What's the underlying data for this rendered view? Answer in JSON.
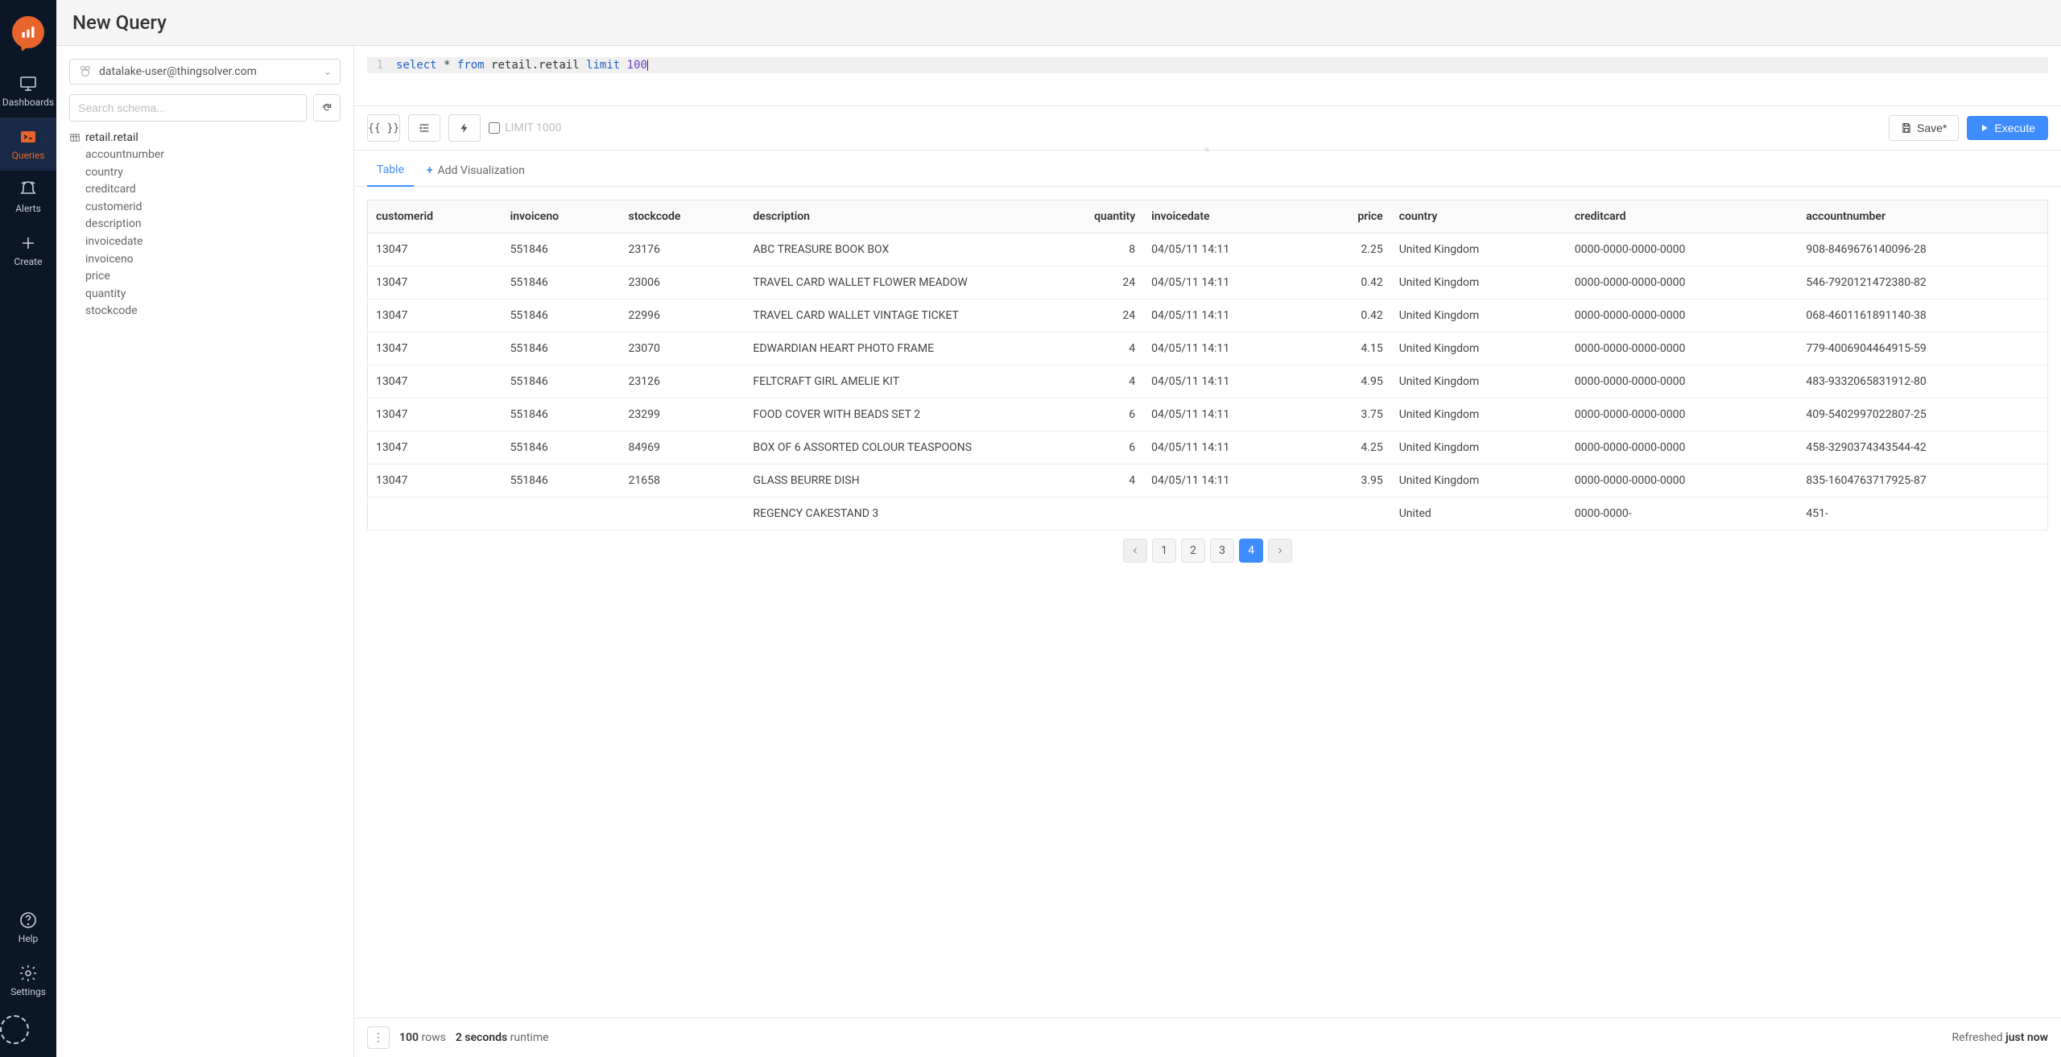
{
  "page_title": "New Query",
  "sidebar": {
    "items": [
      {
        "id": "dashboards",
        "label": "Dashboards"
      },
      {
        "id": "queries",
        "label": "Queries"
      },
      {
        "id": "alerts",
        "label": "Alerts"
      },
      {
        "id": "create",
        "label": "Create"
      }
    ],
    "bottom": [
      {
        "id": "help",
        "label": "Help"
      },
      {
        "id": "settings",
        "label": "Settings"
      }
    ]
  },
  "connection": {
    "selected": "datalake-user@thingsolver.com"
  },
  "schema_search_placeholder": "Search schema...",
  "schema": {
    "table": "retail.retail",
    "columns": [
      "accountnumber",
      "country",
      "creditcard",
      "customerid",
      "description",
      "invoicedate",
      "invoiceno",
      "price",
      "quantity",
      "stockcode"
    ]
  },
  "query": {
    "line_no": "1",
    "tokens": {
      "select": "select",
      "star": "*",
      "from": "from",
      "table": "retail.retail",
      "limit": "limit",
      "n": "100"
    }
  },
  "toolbar": {
    "format_btn": "{{ }}",
    "limit_label": "LIMIT 1000",
    "save_label": "Save*",
    "execute_label": "Execute"
  },
  "tabs": {
    "table": "Table",
    "add": "Add Visualization"
  },
  "columns": [
    "customerid",
    "invoiceno",
    "stockcode",
    "description",
    "quantity",
    "invoicedate",
    "price",
    "country",
    "creditcard",
    "accountnumber"
  ],
  "numeric_cols": [
    "quantity",
    "price"
  ],
  "rows": [
    {
      "customerid": "13047",
      "invoiceno": "551846",
      "stockcode": "23176",
      "description": "ABC TREASURE BOOK BOX",
      "quantity": "8",
      "invoicedate": "04/05/11 14:11",
      "price": "2.25",
      "country": "United Kingdom",
      "creditcard": "0000-0000-0000-0000",
      "accountnumber": "908-8469676140096-28"
    },
    {
      "customerid": "13047",
      "invoiceno": "551846",
      "stockcode": "23006",
      "description": "TRAVEL CARD WALLET FLOWER MEADOW",
      "quantity": "24",
      "invoicedate": "04/05/11 14:11",
      "price": "0.42",
      "country": "United Kingdom",
      "creditcard": "0000-0000-0000-0000",
      "accountnumber": "546-7920121472380-82"
    },
    {
      "customerid": "13047",
      "invoiceno": "551846",
      "stockcode": "22996",
      "description": "TRAVEL CARD WALLET VINTAGE TICKET",
      "quantity": "24",
      "invoicedate": "04/05/11 14:11",
      "price": "0.42",
      "country": "United Kingdom",
      "creditcard": "0000-0000-0000-0000",
      "accountnumber": "068-4601161891140-38"
    },
    {
      "customerid": "13047",
      "invoiceno": "551846",
      "stockcode": "23070",
      "description": "EDWARDIAN HEART PHOTO FRAME",
      "quantity": "4",
      "invoicedate": "04/05/11 14:11",
      "price": "4.15",
      "country": "United Kingdom",
      "creditcard": "0000-0000-0000-0000",
      "accountnumber": "779-4006904464915-59"
    },
    {
      "customerid": "13047",
      "invoiceno": "551846",
      "stockcode": "23126",
      "description": "FELTCRAFT GIRL AMELIE KIT",
      "quantity": "4",
      "invoicedate": "04/05/11 14:11",
      "price": "4.95",
      "country": "United Kingdom",
      "creditcard": "0000-0000-0000-0000",
      "accountnumber": "483-9332065831912-80"
    },
    {
      "customerid": "13047",
      "invoiceno": "551846",
      "stockcode": "23299",
      "description": "FOOD COVER WITH BEADS SET 2",
      "quantity": "6",
      "invoicedate": "04/05/11 14:11",
      "price": "3.75",
      "country": "United Kingdom",
      "creditcard": "0000-0000-0000-0000",
      "accountnumber": "409-5402997022807-25"
    },
    {
      "customerid": "13047",
      "invoiceno": "551846",
      "stockcode": "84969",
      "description": "BOX OF 6 ASSORTED COLOUR TEASPOONS",
      "quantity": "6",
      "invoicedate": "04/05/11 14:11",
      "price": "4.25",
      "country": "United Kingdom",
      "creditcard": "0000-0000-0000-0000",
      "accountnumber": "458-3290374343544-42"
    },
    {
      "customerid": "13047",
      "invoiceno": "551846",
      "stockcode": "21658",
      "description": "GLASS BEURRE DISH",
      "quantity": "4",
      "invoicedate": "04/05/11 14:11",
      "price": "3.95",
      "country": "United Kingdom",
      "creditcard": "0000-0000-0000-0000",
      "accountnumber": "835-1604763717925-87"
    },
    {
      "customerid": "",
      "invoiceno": "",
      "stockcode": "",
      "description": "REGENCY CAKESTAND 3",
      "quantity": "",
      "invoicedate": "",
      "price": "",
      "country": "United",
      "creditcard": "0000-0000-",
      "accountnumber": "451-"
    }
  ],
  "pagination": {
    "pages": [
      "1",
      "2",
      "3",
      "4"
    ],
    "active": "4"
  },
  "footer": {
    "rows_count": "100",
    "rows_label": "rows",
    "runtime_count": "2 seconds",
    "runtime_label": "runtime",
    "refreshed_label": "Refreshed",
    "refreshed_value": "just now"
  }
}
